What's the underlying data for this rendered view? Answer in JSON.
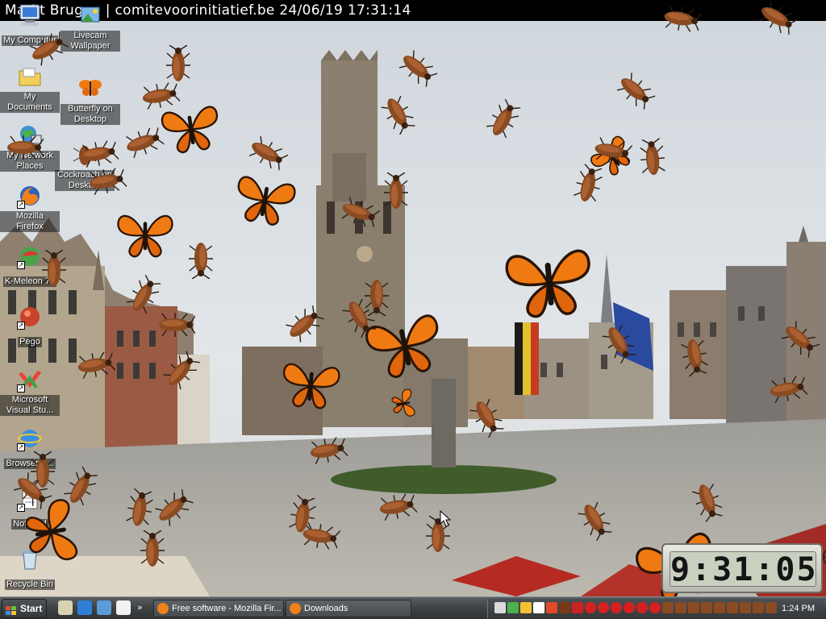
{
  "webcam": {
    "caption": "Markt Brugge | comitevoorinitiatief.be 24/06/19 17:31:14"
  },
  "desktop": {
    "icons": [
      {
        "label": "My Computer",
        "icon": "my-computer-icon"
      },
      {
        "label": "Livecam Wallpaper",
        "icon": "livecam-wallpaper-icon"
      },
      {
        "label": "My Documents",
        "icon": "my-documents-icon"
      },
      {
        "label": "Butterfly on Desktop",
        "icon": "butterfly-icon"
      },
      {
        "label": "My Network Places",
        "icon": "network-places-icon"
      },
      {
        "label": "Cockroach on Desktop",
        "icon": "cockroach-icon"
      },
      {
        "label": "Mozilla Firefox",
        "icon": "firefox-icon"
      },
      {
        "label": "K-Meleon 74",
        "icon": "kmeleon-icon"
      },
      {
        "label": "Pego",
        "icon": "pego-icon"
      },
      {
        "label": "Microsoft Visual Stu...",
        "icon": "visual-studio-icon"
      },
      {
        "label": "BrowserVi...",
        "icon": "browser-icon"
      },
      {
        "label": "Notepad",
        "icon": "notepad-icon"
      },
      {
        "label": "Recycle Bin",
        "icon": "recycle-bin-icon"
      }
    ]
  },
  "clock_gadget": {
    "time": "9:31:05"
  },
  "taskbar": {
    "start_label": "Start",
    "quick_launch": [
      "show-desktop-icon",
      "internet-explorer-icon",
      "windows-media-icon",
      "messenger-icon",
      "outlook-icon"
    ],
    "chevron": "»",
    "tasks": [
      {
        "label": "Free software - Mozilla Fir...",
        "icon": "firefox-icon"
      },
      {
        "label": "Downloads",
        "icon": "firefox-icon"
      }
    ],
    "tray_icons": [
      "volume-icon",
      "network-icon",
      "update-icon",
      "mail-icon",
      "timer-icon",
      "shield-icon",
      "security-icon",
      "red-app-icon",
      "red-app-icon",
      "red-app-icon",
      "red-app-icon",
      "red-app-icon",
      "red-app-icon",
      "bug-icon",
      "bug-icon",
      "bug-icon",
      "bug-icon",
      "bug-icon",
      "bug-icon",
      "bug-icon",
      "bug-icon",
      "bug-icon"
    ],
    "tray_time": "1:24 PM"
  },
  "colors": {
    "taskbar": "#3f4447",
    "butterfly": "#f07a12",
    "cockroach": "#8a4a22",
    "sky": "#d7dde2"
  }
}
